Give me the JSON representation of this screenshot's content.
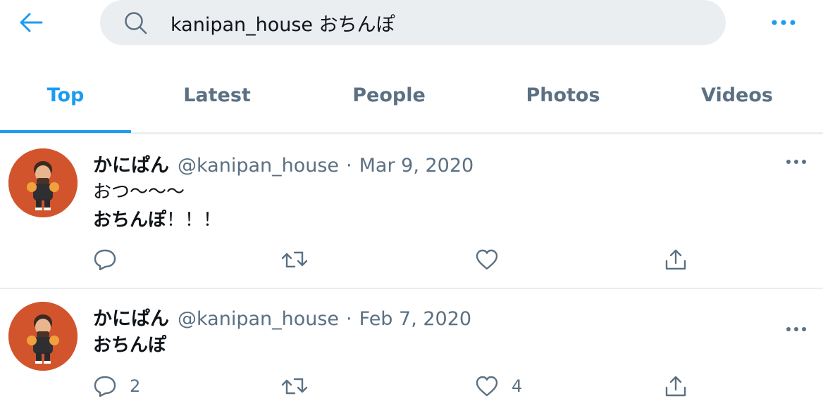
{
  "search": {
    "query": "kanipan_house おちんぽ"
  },
  "tabs": [
    {
      "label": "Top",
      "active": true
    },
    {
      "label": "Latest",
      "active": false
    },
    {
      "label": "People",
      "active": false
    },
    {
      "label": "Photos",
      "active": false
    },
    {
      "label": "Videos",
      "active": false
    }
  ],
  "colors": {
    "accent": "#1d9bf0",
    "secondary_text": "#5b7083",
    "avatar_bg": "#d2542c"
  },
  "tweets": [
    {
      "display_name": "かにぱん",
      "handle": "@kanipan_house",
      "separator": "·",
      "date": "Mar 9, 2020",
      "lines": [
        "おつ〜〜〜",
        "おちんぽ！！！"
      ],
      "bold_prefix": "おちんぽ",
      "bold_suffix": "！！！",
      "reply_count": "",
      "retweet_count": "",
      "like_count": ""
    },
    {
      "display_name": "かにぱん",
      "handle": "@kanipan_house",
      "separator": "·",
      "date": "Feb 7, 2020",
      "lines": [
        "おちんぽ"
      ],
      "reply_count": "2",
      "retweet_count": "",
      "like_count": "4"
    }
  ]
}
